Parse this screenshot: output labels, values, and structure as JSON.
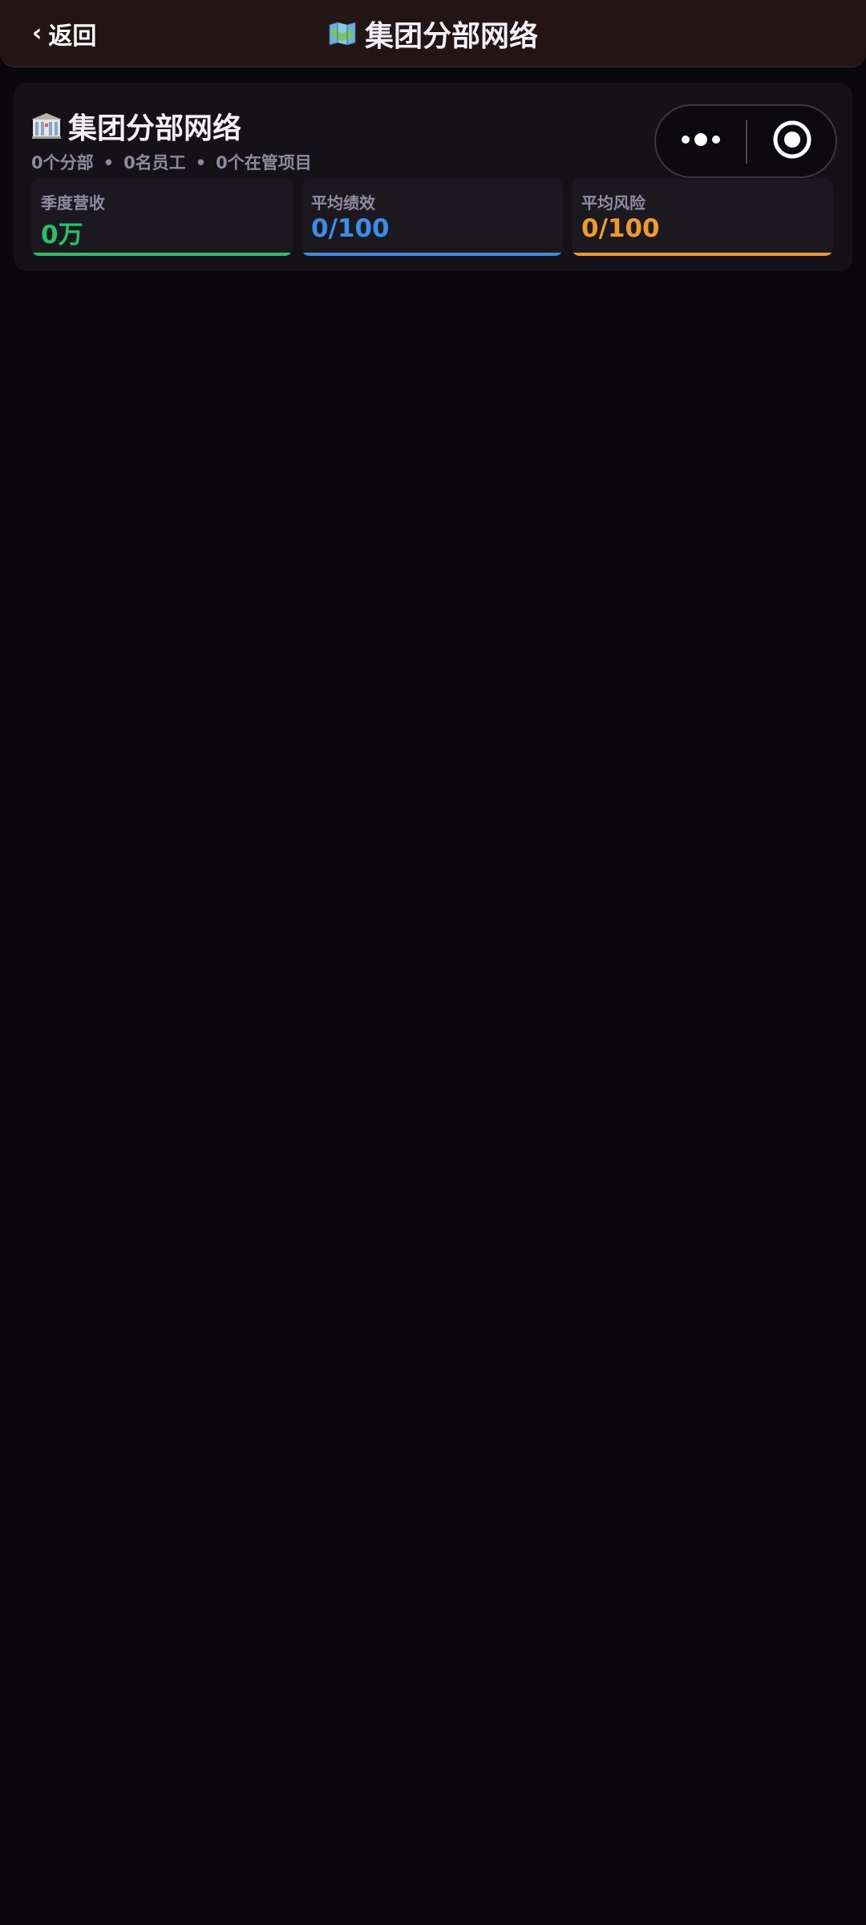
{
  "nav": {
    "back_label": "返回",
    "title": "集团分部网络",
    "icon": "map-icon"
  },
  "summary": {
    "title": "集团分部网络",
    "icon": "bank-icon",
    "branches": "0个分部",
    "employees": "0名员工",
    "projects": "0个在管项目",
    "separator": "•"
  },
  "stats": [
    {
      "label": "季度营收",
      "value": "0万",
      "color": "#2bbf6a"
    },
    {
      "label": "平均绩效",
      "value": "0/100",
      "color": "#3c8ce8"
    },
    {
      "label": "平均风险",
      "value": "0/100",
      "color": "#f09a2a"
    }
  ],
  "capsule": {
    "more_icon": "more-dots-icon",
    "close_icon": "target-close-icon"
  }
}
